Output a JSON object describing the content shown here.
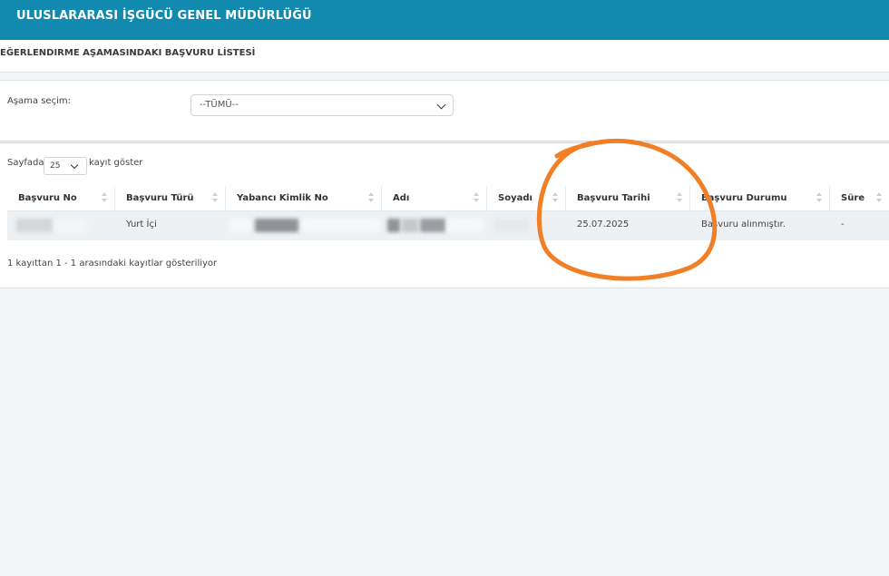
{
  "header": {
    "title": "ULUSLARARASI İŞGÜCÜ GENEL MÜDÜRLÜĞÜ"
  },
  "panel": {
    "heading": "EĞERLENDIRME AŞAMASINDAKI BAŞVURU LİSTESİ"
  },
  "filter": {
    "label": "Aşama seçim:",
    "selected": "--TÜMÜ--"
  },
  "pagination": {
    "prefix": "Sayfada",
    "page_size": "25",
    "suffix": "kayıt göster",
    "info": "1 kayıttan 1 - 1 arasındaki kayıtlar gösteriliyor"
  },
  "table": {
    "columns": [
      "Başvuru No",
      "Başvuru Türü",
      "Yabancı Kimlik No",
      "Adı",
      "Soyadı",
      "Başvuru Tarihi",
      "Başvuru Durumu",
      "Süre"
    ],
    "rows": [
      {
        "basvuru_no": "",
        "basvuru_turu": "Yurt İçi",
        "kimlik_no": "",
        "adi": "",
        "soyadi": "",
        "tarih": "25.07.2025",
        "durum": "Başvuru alınmıştır.",
        "sure": "-"
      }
    ]
  },
  "annotation": {
    "color": "#f07f26"
  },
  "colors": {
    "header": "#1289ae",
    "background": "#f2f6f9"
  }
}
